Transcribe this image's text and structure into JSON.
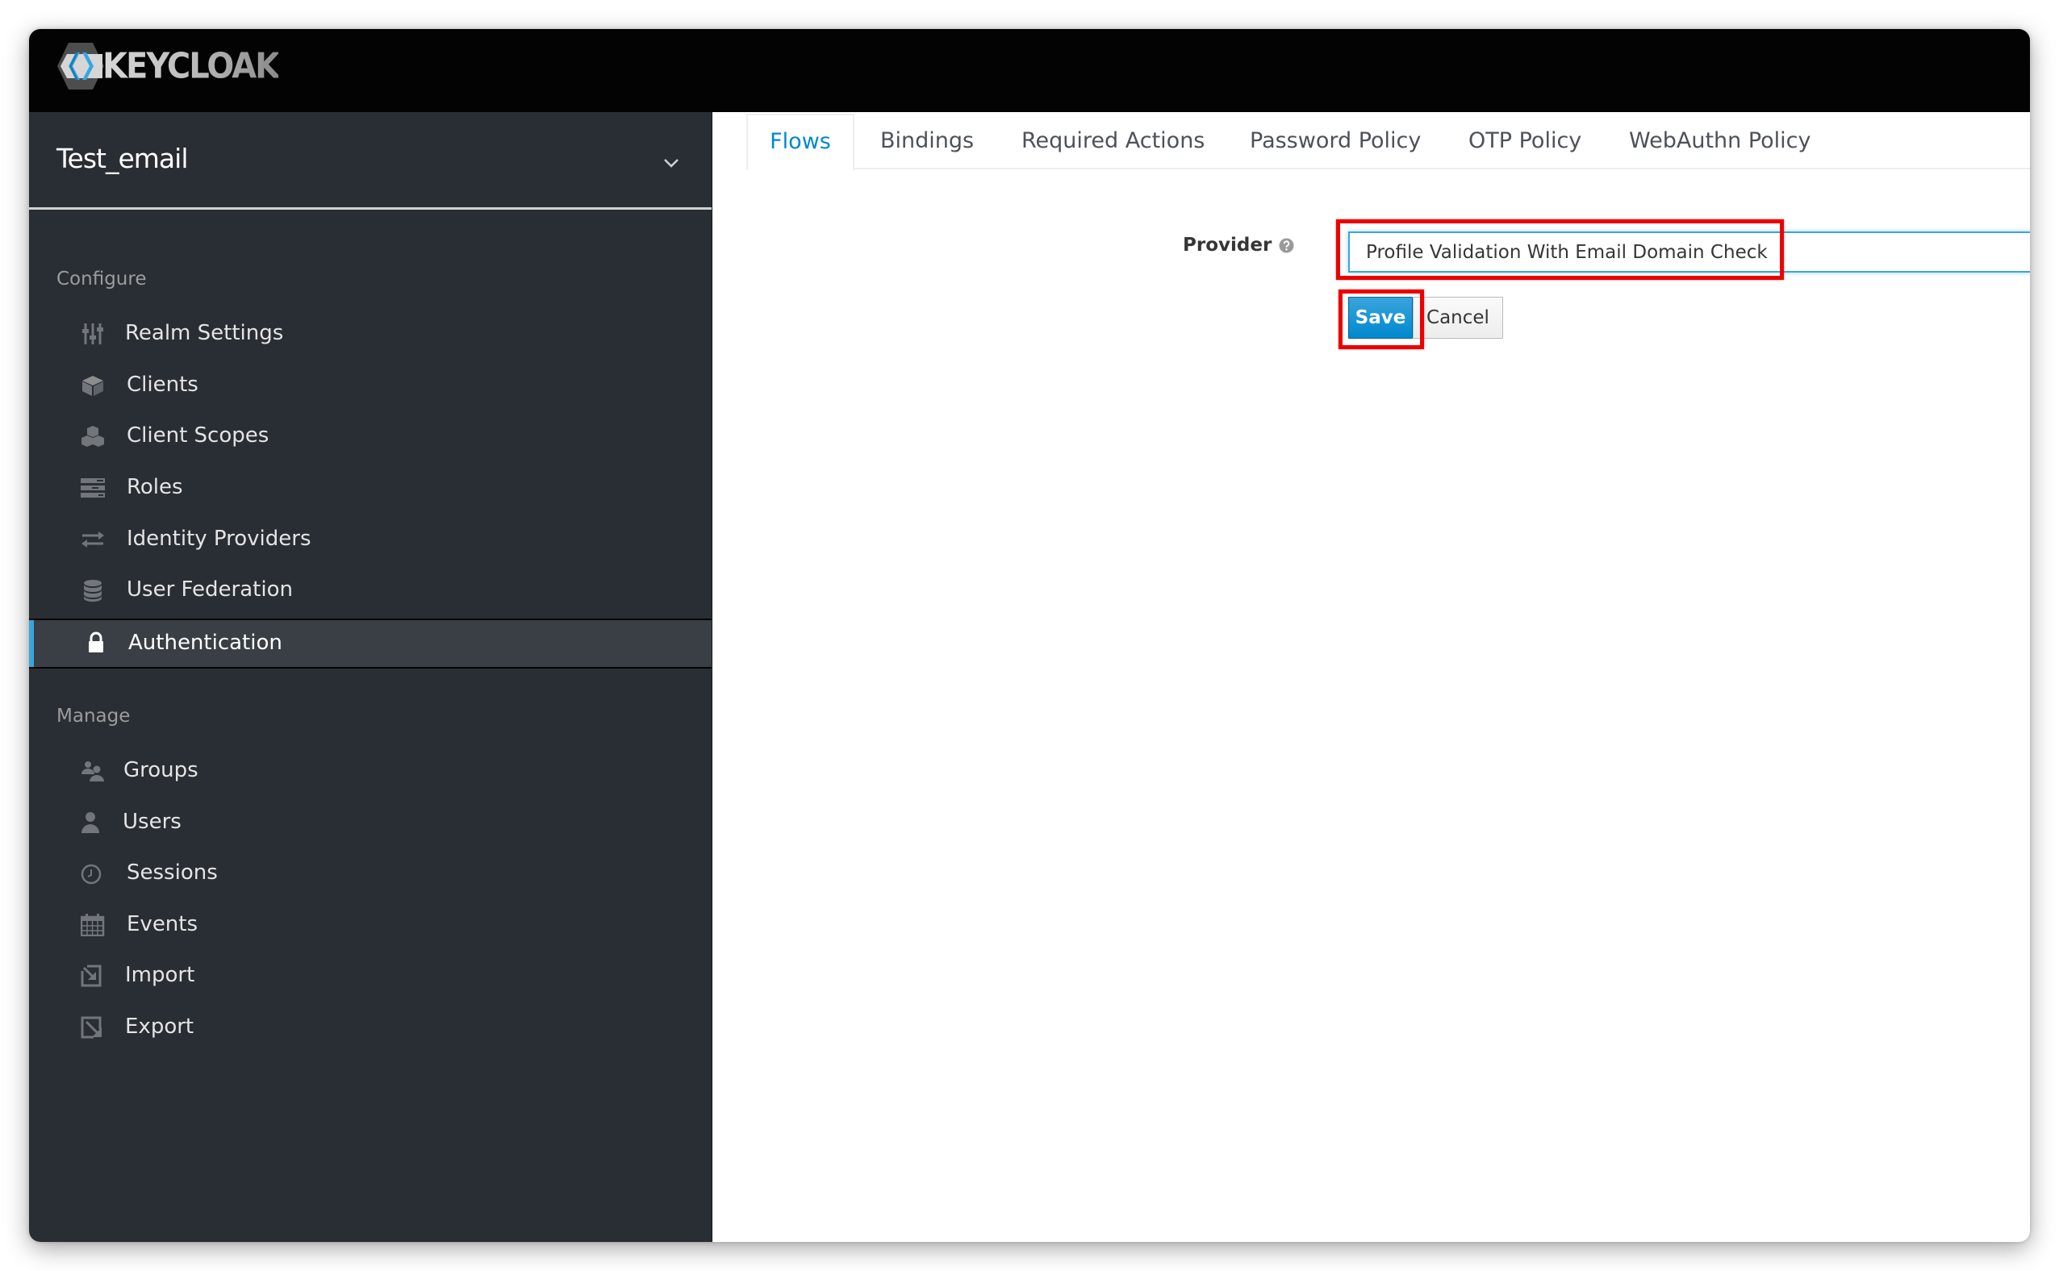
{
  "app": {
    "brand": "KEYCLOAK",
    "logo_icon": "keycloak-logo-icon"
  },
  "sidebar": {
    "realm": {
      "name": "Test_email",
      "dropdown_icon": "chevron-down-icon"
    },
    "sections": [
      {
        "label": "Configure",
        "items": [
          {
            "label": "Realm Settings",
            "icon": "sliders-icon",
            "active": false
          },
          {
            "label": "Clients",
            "icon": "cube-icon",
            "active": false
          },
          {
            "label": "Client Scopes",
            "icon": "cubes-icon",
            "active": false
          },
          {
            "label": "Roles",
            "icon": "server-icon",
            "active": false
          },
          {
            "label": "Identity Providers",
            "icon": "exchange-icon",
            "active": false
          },
          {
            "label": "User Federation",
            "icon": "database-icon",
            "active": false
          },
          {
            "label": "Authentication",
            "icon": "lock-icon",
            "active": true
          }
        ]
      },
      {
        "label": "Manage",
        "items": [
          {
            "label": "Groups",
            "icon": "users-icon",
            "active": false
          },
          {
            "label": "Users",
            "icon": "user-icon",
            "active": false
          },
          {
            "label": "Sessions",
            "icon": "clock-icon",
            "active": false
          },
          {
            "label": "Events",
            "icon": "calendar-icon",
            "active": false
          },
          {
            "label": "Import",
            "icon": "import-icon",
            "active": false
          },
          {
            "label": "Export",
            "icon": "export-icon",
            "active": false
          }
        ]
      }
    ]
  },
  "main": {
    "tabs": [
      {
        "label": "Flows",
        "active": true
      },
      {
        "label": "Bindings",
        "active": false
      },
      {
        "label": "Required Actions",
        "active": false
      },
      {
        "label": "Password Policy",
        "active": false
      },
      {
        "label": "OTP Policy",
        "active": false
      },
      {
        "label": "WebAuthn Policy",
        "active": false
      }
    ],
    "form": {
      "provider_label": "Provider",
      "provider_help_icon": "question-circle-icon",
      "provider_value": "Profile Validation With Email Domain Check",
      "save_label": "Save",
      "cancel_label": "Cancel"
    }
  },
  "colors": {
    "accent": "#0088ce",
    "active_indicator": "#39a5dc",
    "highlight_annotation": "#ec0000",
    "sidebar_bg": "#292e34",
    "masthead_bg": "#030303"
  }
}
